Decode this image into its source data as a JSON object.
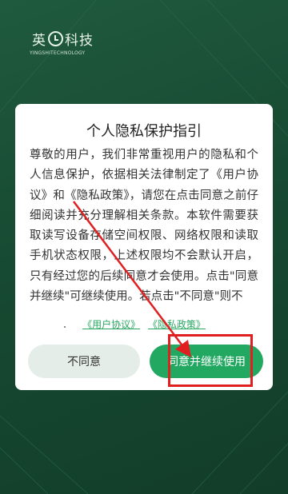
{
  "logo": {
    "name": "英科技",
    "subtitle": "YINGSHITECHNOLOGY"
  },
  "dialog": {
    "title": "个人隐私保护指引",
    "body": "尊敬的用户，我们非常重视用户的隐私和个人信息保护，依据相关法律制定了《用户协议》和《隐私政策》，请您在点击同意之前仔细阅读并充分理解相关条款。本软件需要获取读写设备存储空间权限、网络权限和读取手机状态权限，上述权限均不会默认开启，只有经过您的后续同意才会使用。点击\"同意并继续\"可继续使用。若点击\"不同意\"则不",
    "links": {
      "agreement": "《用户协议》",
      "privacy": "《隐私政策》"
    },
    "buttons": {
      "disagree": "不同意",
      "agree": "同意并继续使用"
    }
  },
  "colors": {
    "background": "#1a4d35",
    "accent": "#23a862",
    "annotation": "#e02020"
  }
}
